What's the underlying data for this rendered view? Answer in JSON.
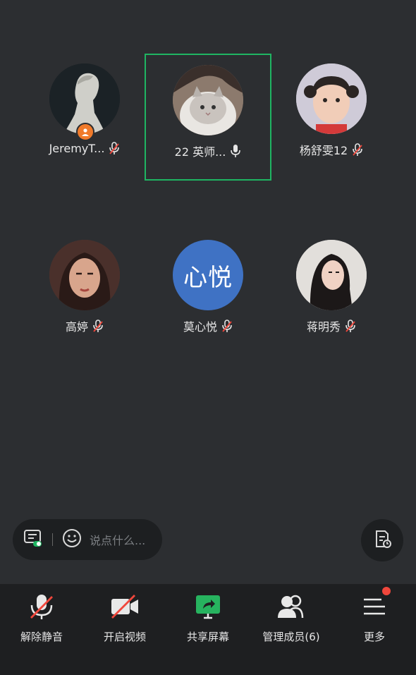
{
  "participants": [
    {
      "name": "JeremyT...",
      "mic": "muted",
      "host": true
    },
    {
      "name": "22 英师...",
      "mic": "on",
      "speaking": true
    },
    {
      "name": "杨舒雯12",
      "mic": "muted"
    },
    {
      "name": "高婷",
      "mic": "muted"
    },
    {
      "name": "莫心悦",
      "mic": "muted",
      "avatar_text": "心悦",
      "avatar_color": "#3f72c4"
    },
    {
      "name": "蒋明秀",
      "mic": "muted"
    }
  ],
  "chat": {
    "placeholder": "说点什么..."
  },
  "toolbar": {
    "unmute_label": "解除静音",
    "video_label": "开启视频",
    "share_label": "共享屏幕",
    "members_label": "管理成员(6)",
    "more_label": "更多"
  },
  "colors": {
    "background": "#2c2e31",
    "toolbar": "#1e1f21",
    "speaking_border": "#1fb562",
    "share_green": "#27b35f",
    "mute_red": "#f0473c"
  }
}
